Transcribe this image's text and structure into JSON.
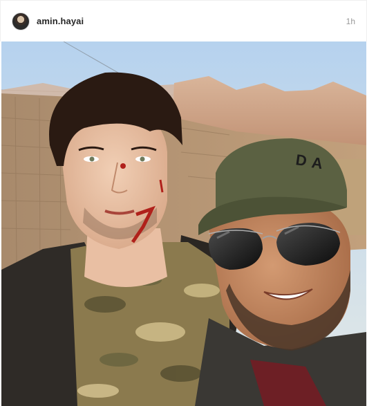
{
  "post": {
    "username": "amin.hayai",
    "timestamp": "1h",
    "avatar_icon": "profile-avatar",
    "photo_description_icon": "selfie-photo"
  },
  "colors": {
    "sky_top": "#b9d4ee",
    "sky_bottom": "#dfe9ef",
    "mountains": "#c99c7e",
    "wall": "#b39372",
    "cap": "#5b6142",
    "camo_base": "#8c7a4e",
    "jacket": "#2f2b27"
  }
}
